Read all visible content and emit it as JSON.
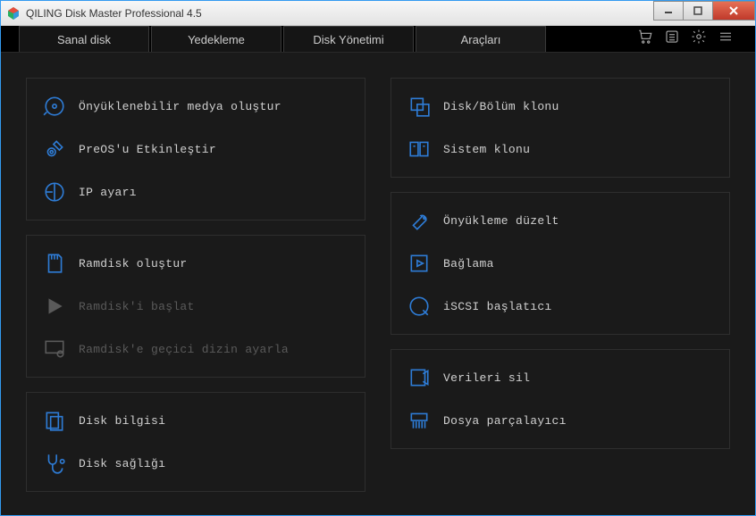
{
  "titlebar": {
    "title": "QILING Disk Master Professional 4.5"
  },
  "tabs": [
    {
      "label": "Sanal disk",
      "active": false
    },
    {
      "label": "Yedekleme",
      "active": false
    },
    {
      "label": "Disk Yönetimi",
      "active": false
    },
    {
      "label": "Araçları",
      "active": true
    }
  ],
  "left_panels": [
    {
      "items": [
        {
          "icon": "disc-icon",
          "label": "Önyüklenebilir medya oluştur",
          "disabled": false
        },
        {
          "icon": "gear-wrench-icon",
          "label": "PreOS'u Etkinleştir",
          "disabled": false
        },
        {
          "icon": "network-icon",
          "label": "IP ayarı",
          "disabled": false
        }
      ]
    },
    {
      "items": [
        {
          "icon": "sdcard-icon",
          "label": "Ramdisk oluştur",
          "disabled": false
        },
        {
          "icon": "play-icon",
          "label": "Ramdisk'i başlat",
          "disabled": true
        },
        {
          "icon": "monitor-gear-icon",
          "label": "Ramdisk'e geçici dizin ayarla",
          "disabled": true
        }
      ]
    },
    {
      "items": [
        {
          "icon": "disk-info-icon",
          "label": "Disk bilgisi",
          "disabled": false
        },
        {
          "icon": "stethoscope-icon",
          "label": "Disk sağlığı",
          "disabled": false
        }
      ]
    }
  ],
  "right_panels": [
    {
      "items": [
        {
          "icon": "clone-icon",
          "label": "Disk/Bölüm klonu",
          "disabled": false
        },
        {
          "icon": "migrate-icon",
          "label": "Sistem klonu",
          "disabled": false
        }
      ]
    },
    {
      "items": [
        {
          "icon": "wrench-icon",
          "label": "Önyükleme düzelt",
          "disabled": false
        },
        {
          "icon": "mount-icon",
          "label": "Bağlama",
          "disabled": false
        },
        {
          "icon": "iscsi-icon",
          "label": "iSCSI başlatıcı",
          "disabled": false
        }
      ]
    },
    {
      "items": [
        {
          "icon": "erase-icon",
          "label": "Verileri sil",
          "disabled": false
        },
        {
          "icon": "shredder-icon",
          "label": "Dosya parçalayıcı",
          "disabled": false
        }
      ]
    }
  ]
}
